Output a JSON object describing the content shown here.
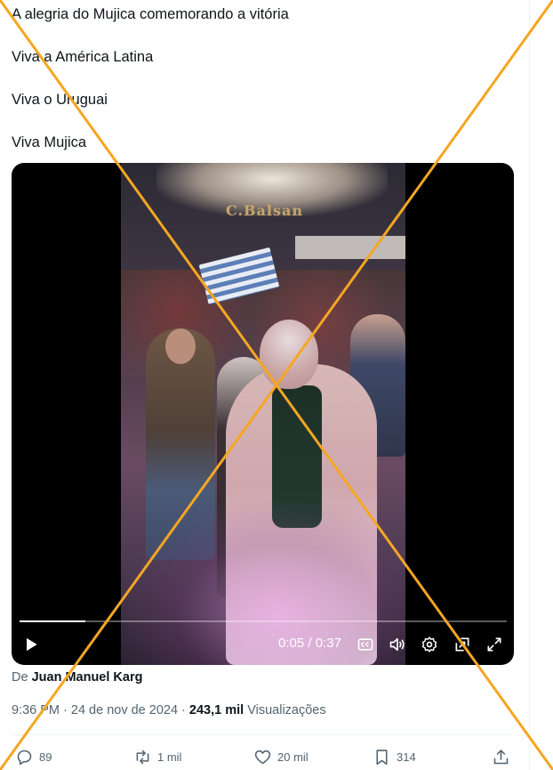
{
  "tweet": {
    "lines": [
      "A alegria do Mujica comemorando a vitória",
      "Viva a América Latina",
      "Viva o Uruguai",
      "Viva Mujica"
    ]
  },
  "video": {
    "scene_sign": "C.Balsan",
    "current_time": "0:05",
    "duration": "0:37",
    "time_separator": " / ",
    "progress_fraction": 0.135,
    "icons": [
      "play-icon",
      "captions-icon",
      "volume-icon",
      "settings-icon",
      "picture-in-picture-icon",
      "fullscreen-icon"
    ]
  },
  "author": {
    "prefix": "De ",
    "name": "Juan Manuel Karg"
  },
  "meta": {
    "time": "9:36 PM",
    "date": "24 de nov de 2024",
    "separator": " · ",
    "views_count": "243,1 mil",
    "views_label": " Visualizações"
  },
  "actions": {
    "replies": "89",
    "reposts": "1 mil",
    "likes": "20 mil",
    "bookmarks": "314"
  },
  "colors": {
    "text_primary": "#0f1419",
    "text_secondary": "#536471",
    "overlay_cross": "#f5a623"
  }
}
